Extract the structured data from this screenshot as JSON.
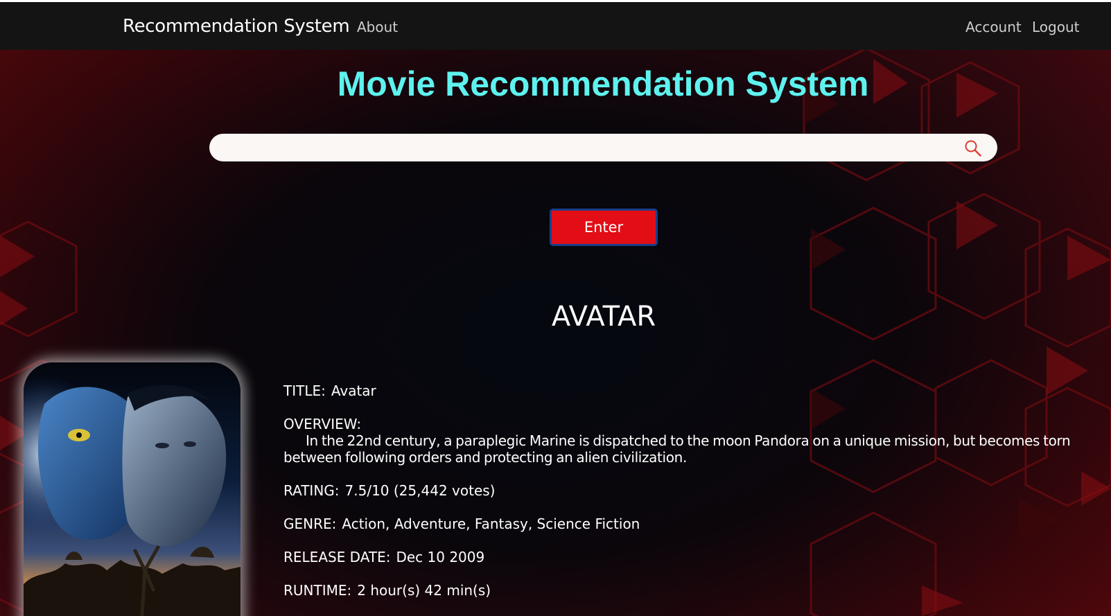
{
  "navbar": {
    "brand": "Recommendation System",
    "links": {
      "about": "About",
      "account": "Account",
      "logout": "Logout"
    }
  },
  "hero": {
    "title": "Movie Recommendation System"
  },
  "search": {
    "value": "",
    "placeholder": ""
  },
  "enter_button": {
    "label": "Enter"
  },
  "movie": {
    "heading": "AVATAR",
    "title_label": "TITLE:",
    "title_value": "Avatar",
    "overview_label": "OVERVIEW:",
    "overview_value": "In the 22nd century, a paraplegic Marine is dispatched to the moon Pandora on a unique mission, but becomes torn between following orders and protecting an alien civilization.",
    "rating_label": "RATING:",
    "rating_value": "7.5/10 (25,442 votes)",
    "genre_label": "GENRE:",
    "genre_value": "Action, Adventure, Fantasy, Science Fiction",
    "release_label": "RELEASE DATE:",
    "release_value": "Dec 10 2009",
    "runtime_label": "RUNTIME:",
    "runtime_value": "2 hour(s) 42 min(s)"
  },
  "colors": {
    "title_accent": "#5ef2ef",
    "enter_button": "#e30d15",
    "enter_border": "#1a3f8a",
    "navbar": "#141414"
  },
  "icons": {
    "search": "search-icon"
  }
}
